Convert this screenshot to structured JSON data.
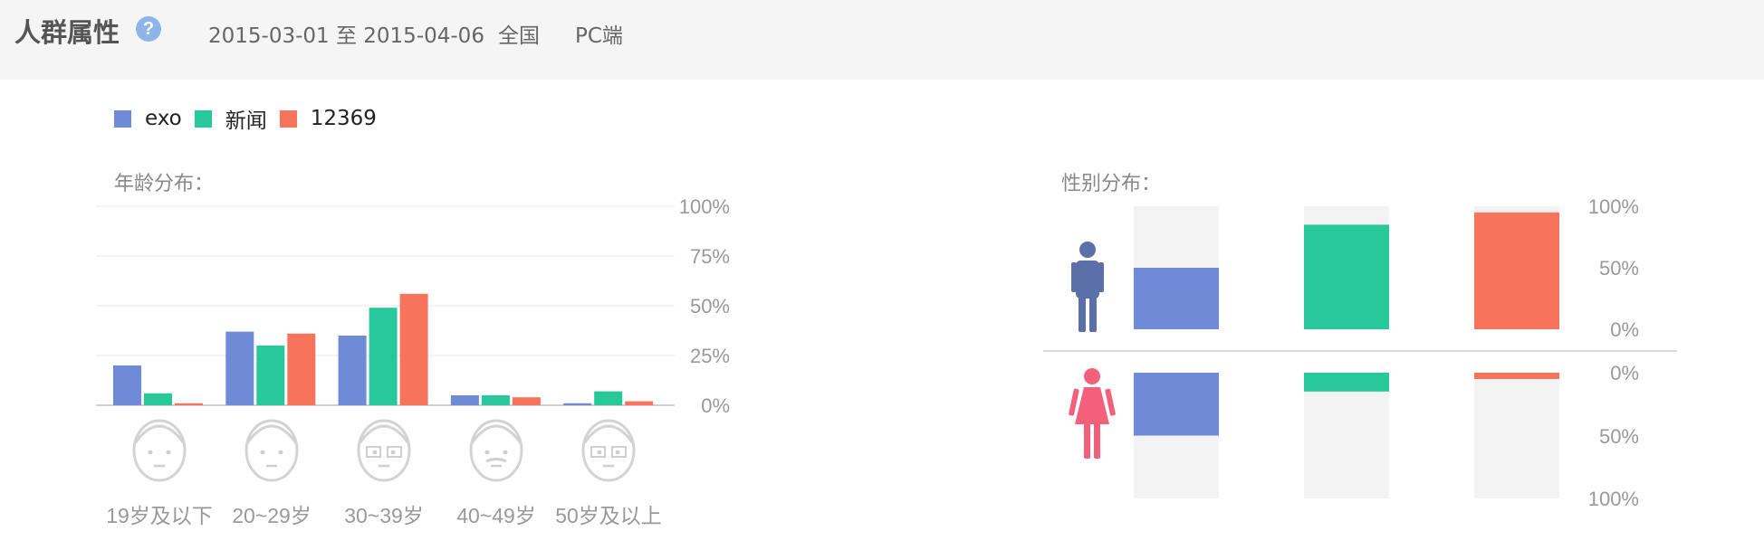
{
  "header": {
    "title": "人群属性",
    "help_icon": "?",
    "date_range": "2015-03-01 至 2015-04-06",
    "region": "全国",
    "platform": "PC端"
  },
  "legend": [
    {
      "name": "exo",
      "color": "#6f8ad6"
    },
    {
      "name": "新闻",
      "color": "#27c89a"
    },
    {
      "name": "12369",
      "color": "#f7735c"
    }
  ],
  "age_section": {
    "label": "年龄分布："
  },
  "gender_section": {
    "label": "性别分布："
  },
  "chart_data": [
    {
      "type": "bar",
      "title": "年龄分布：",
      "categories": [
        "19岁及以下",
        "20~29岁",
        "30~39岁",
        "40~49岁",
        "50岁及以上"
      ],
      "series": [
        {
          "name": "exo",
          "values": [
            20,
            37,
            35,
            5,
            1
          ],
          "color": "#6f8ad6"
        },
        {
          "name": "新闻",
          "values": [
            6,
            30,
            49,
            5,
            7
          ],
          "color": "#27c89a"
        },
        {
          "name": "12369",
          "values": [
            1,
            36,
            56,
            4,
            2
          ],
          "color": "#f7735c"
        }
      ],
      "ylim": [
        0,
        100
      ],
      "yticks": [
        "0%",
        "25%",
        "50%",
        "75%",
        "100%"
      ],
      "grid": true,
      "category_icons": [
        "child-face-icon",
        "young-adult-face-icon",
        "glasses-face-icon",
        "mustache-face-icon",
        "elderly-face-icon"
      ]
    },
    {
      "type": "bar",
      "title": "性别分布：",
      "categories": [
        "exo",
        "新闻",
        "12369"
      ],
      "series": [
        {
          "name": "男",
          "values": [
            50,
            85,
            95
          ],
          "icon": "male-icon",
          "icon_color": "#5b6fa8"
        },
        {
          "name": "女",
          "values": [
            50,
            15,
            5
          ],
          "icon": "female-icon",
          "icon_color": "#f2607a"
        }
      ],
      "colors": [
        "#6f8ad6",
        "#27c89a",
        "#f7735c"
      ],
      "ylim": [
        0,
        100
      ],
      "yticks_top": [
        "0%",
        "50%",
        "100%"
      ],
      "yticks_bottom": [
        "0%",
        "50%",
        "100%"
      ]
    }
  ]
}
